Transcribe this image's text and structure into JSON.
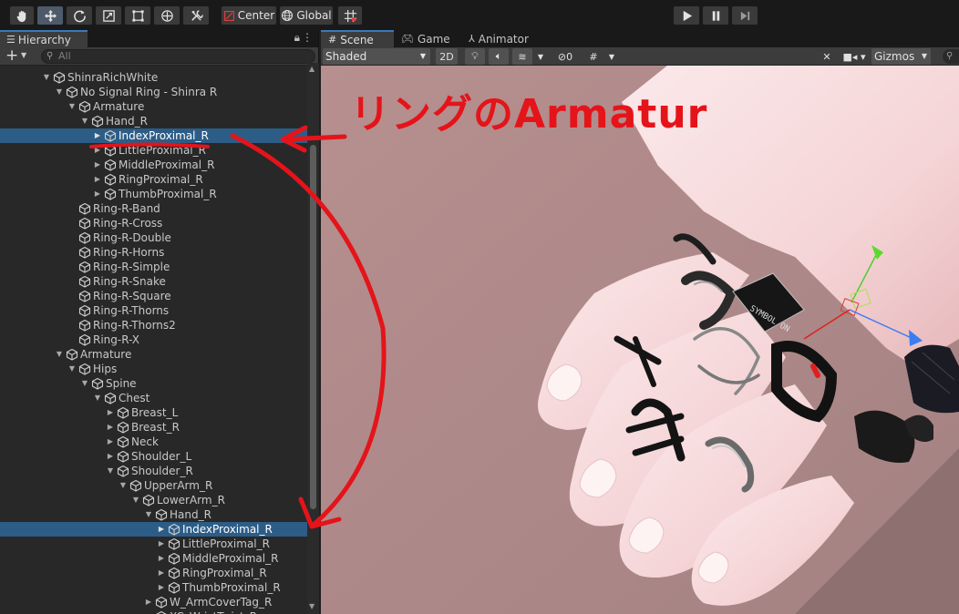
{
  "toolbar": {
    "tools": [
      {
        "name": "hand-tool",
        "icon": "hand-icon"
      },
      {
        "name": "move-tool",
        "icon": "move-icon",
        "active": true
      },
      {
        "name": "rotate-tool",
        "icon": "rotate-icon"
      },
      {
        "name": "scale-tool",
        "icon": "scale-icon"
      },
      {
        "name": "rect-tool",
        "icon": "rect-transform-icon"
      },
      {
        "name": "transform-tool",
        "icon": "transform-icon"
      },
      {
        "name": "custom-tool",
        "icon": "tools-icon"
      }
    ],
    "pivot_label": "Center",
    "space_label": "Global",
    "snap_icon": "grid-snap-icon",
    "play_icon": "play-icon",
    "pause_icon": "pause-icon",
    "step_icon": "step-icon"
  },
  "hierarchy": {
    "tab_label": "Hierarchy",
    "search_placeholder": "All",
    "rows": [
      {
        "label": "ShinraRichWhite",
        "depth": 1,
        "expand": "down",
        "selected": false
      },
      {
        "label": "No Signal Ring - Shinra R",
        "depth": 2,
        "expand": "down",
        "selected": false
      },
      {
        "label": "Armature",
        "depth": 3,
        "expand": "down",
        "selected": false
      },
      {
        "label": "Hand_R",
        "depth": 4,
        "expand": "down",
        "selected": false
      },
      {
        "label": "IndexProximal_R",
        "depth": 5,
        "expand": "right",
        "selected": true
      },
      {
        "label": "LittleProximal_R",
        "depth": 5,
        "expand": "right",
        "selected": false
      },
      {
        "label": "MiddleProximal_R",
        "depth": 5,
        "expand": "right",
        "selected": false
      },
      {
        "label": "RingProximal_R",
        "depth": 5,
        "expand": "right",
        "selected": false
      },
      {
        "label": "ThumbProximal_R",
        "depth": 5,
        "expand": "right",
        "selected": false
      },
      {
        "label": "Ring-R-Band",
        "depth": 3,
        "expand": "none",
        "selected": false
      },
      {
        "label": "Ring-R-Cross",
        "depth": 3,
        "expand": "none",
        "selected": false
      },
      {
        "label": "Ring-R-Double",
        "depth": 3,
        "expand": "none",
        "selected": false
      },
      {
        "label": "Ring-R-Horns",
        "depth": 3,
        "expand": "none",
        "selected": false
      },
      {
        "label": "Ring-R-Simple",
        "depth": 3,
        "expand": "none",
        "selected": false
      },
      {
        "label": "Ring-R-Snake",
        "depth": 3,
        "expand": "none",
        "selected": false
      },
      {
        "label": "Ring-R-Square",
        "depth": 3,
        "expand": "none",
        "selected": false
      },
      {
        "label": "Ring-R-Thorns",
        "depth": 3,
        "expand": "none",
        "selected": false
      },
      {
        "label": "Ring-R-Thorns2",
        "depth": 3,
        "expand": "none",
        "selected": false
      },
      {
        "label": "Ring-R-X",
        "depth": 3,
        "expand": "none",
        "selected": false
      },
      {
        "label": "Armature",
        "depth": 2,
        "expand": "down",
        "selected": false
      },
      {
        "label": "Hips",
        "depth": 3,
        "expand": "down",
        "selected": false
      },
      {
        "label": "Spine",
        "depth": 4,
        "expand": "down",
        "selected": false
      },
      {
        "label": "Chest",
        "depth": 5,
        "expand": "down",
        "selected": false
      },
      {
        "label": "Breast_L",
        "depth": 6,
        "expand": "right",
        "selected": false
      },
      {
        "label": "Breast_R",
        "depth": 6,
        "expand": "right",
        "selected": false
      },
      {
        "label": "Neck",
        "depth": 6,
        "expand": "right",
        "selected": false
      },
      {
        "label": "Shoulder_L",
        "depth": 6,
        "expand": "right",
        "selected": false
      },
      {
        "label": "Shoulder_R",
        "depth": 6,
        "expand": "down",
        "selected": false
      },
      {
        "label": "UpperArm_R",
        "depth": 7,
        "expand": "down",
        "selected": false
      },
      {
        "label": "LowerArm_R",
        "depth": 8,
        "expand": "down",
        "selected": false
      },
      {
        "label": "Hand_R",
        "depth": 9,
        "expand": "down",
        "selected": false
      },
      {
        "label": "IndexProximal_R",
        "depth": 10,
        "expand": "right",
        "selected": true
      },
      {
        "label": "LittleProximal_R",
        "depth": 10,
        "expand": "right",
        "selected": false
      },
      {
        "label": "MiddleProximal_R",
        "depth": 10,
        "expand": "right",
        "selected": false
      },
      {
        "label": "RingProximal_R",
        "depth": 10,
        "expand": "right",
        "selected": false
      },
      {
        "label": "ThumbProximal_R",
        "depth": 10,
        "expand": "right",
        "selected": false
      },
      {
        "label": "W_ArmCoverTag_R",
        "depth": 9,
        "expand": "right",
        "selected": false
      },
      {
        "label": "XC_WristTwist_R",
        "depth": 9,
        "expand": "right",
        "selected": false
      }
    ]
  },
  "scene": {
    "tabs": [
      {
        "label": "Scene",
        "icon": "grid-icon",
        "active": true
      },
      {
        "label": "Game",
        "icon": "gamepad-icon",
        "active": false
      },
      {
        "label": "Animator",
        "icon": "animator-icon",
        "active": false
      }
    ],
    "shading_mode": "Shaded",
    "mode_2d_label": "2D",
    "hidden_count": "0",
    "gizmos_label": "Gizmos",
    "ring_plate_text": "SYMBOL ON"
  },
  "annotation": {
    "text": "リングのArmatur",
    "color": "#e4141a"
  },
  "colors": {
    "selection": "#2c5d87",
    "accent_tab": "#3a79bb",
    "scene_bg": "#b08c8c"
  }
}
